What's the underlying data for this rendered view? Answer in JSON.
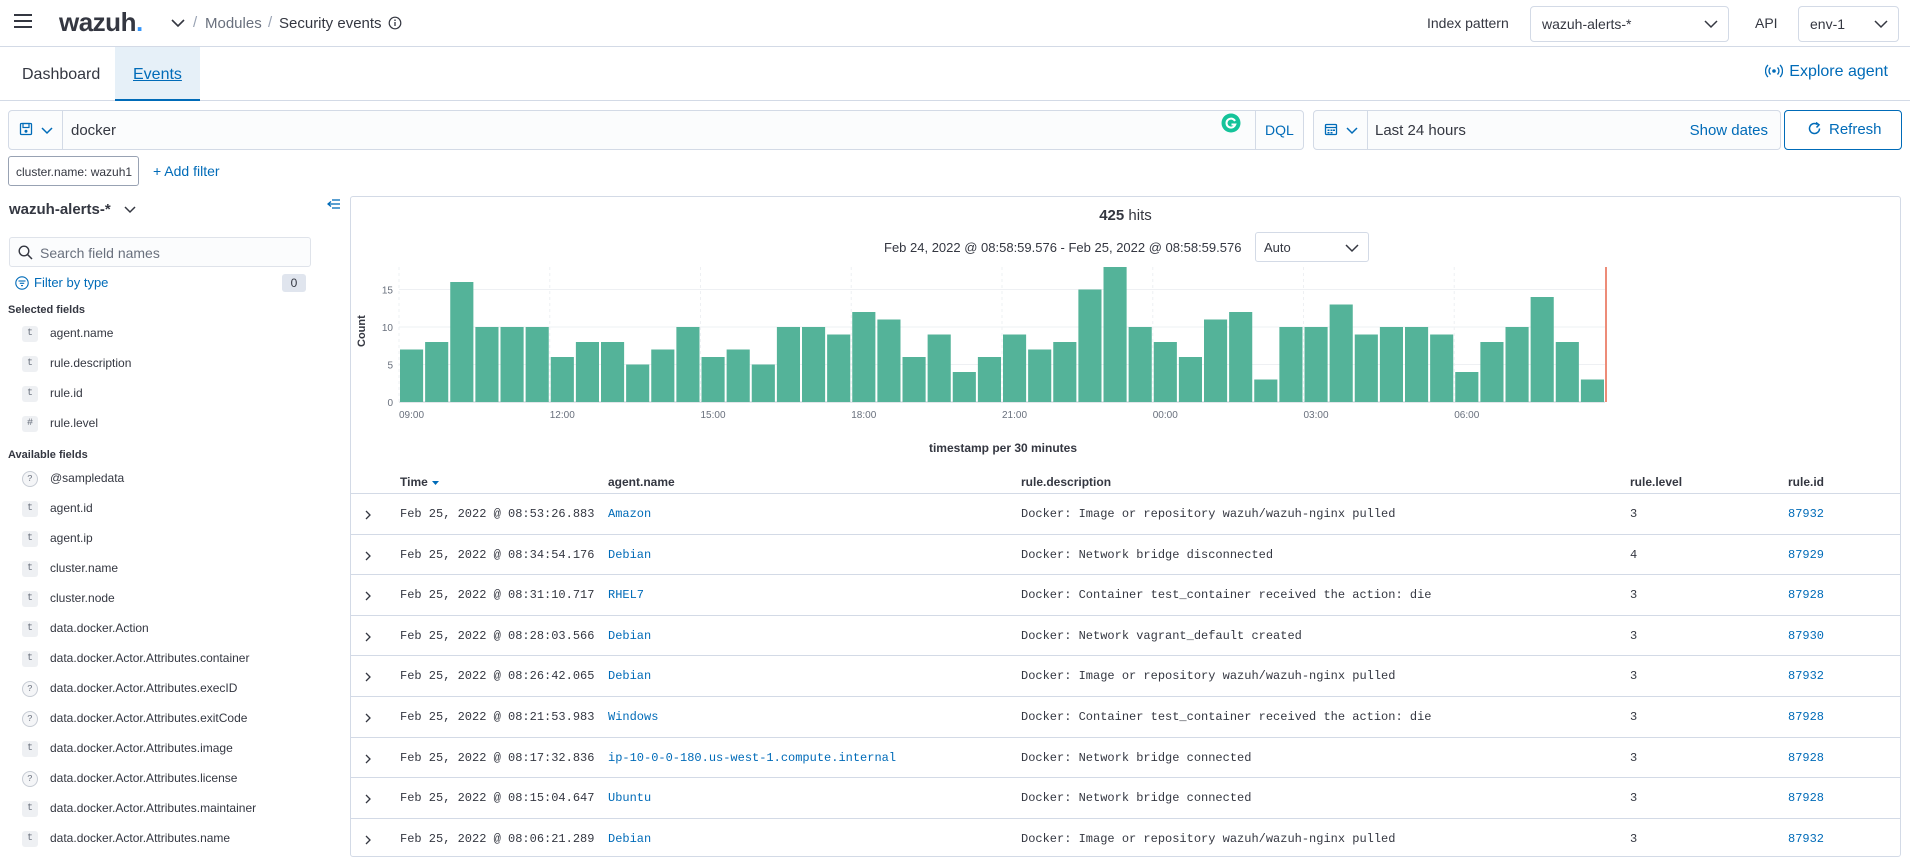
{
  "header": {
    "logo_text": "wazuh",
    "logo_dot": ".",
    "breadcrumb": [
      "Modules",
      "Security events"
    ],
    "index_pattern_label": "Index pattern",
    "index_pattern_value": "wazuh-alerts-*",
    "api_label": "API",
    "api_value": "env-1"
  },
  "tabs": [
    {
      "label": "Dashboard",
      "active": false
    },
    {
      "label": "Events",
      "active": true
    }
  ],
  "explore_agent_label": "Explore agent",
  "query": {
    "value": "docker",
    "language": "DQL"
  },
  "time": {
    "range_label": "Last 24 hours",
    "show_dates": "Show dates",
    "refresh": "Refresh"
  },
  "filters": {
    "pill": "cluster.name: wazuh1",
    "add_filter": "+ Add filter"
  },
  "sidebar": {
    "index_name": "wazuh-alerts-*",
    "search_placeholder": "Search field names",
    "filter_by_type": "Filter by type",
    "filter_count": "0",
    "selected_heading": "Selected fields",
    "selected_fields": [
      {
        "name": "agent.name",
        "type": "t"
      },
      {
        "name": "rule.description",
        "type": "t"
      },
      {
        "name": "rule.id",
        "type": "t"
      },
      {
        "name": "rule.level",
        "type": "#"
      }
    ],
    "available_heading": "Available fields",
    "available_fields": [
      {
        "name": "@sampledata",
        "type": "?"
      },
      {
        "name": "agent.id",
        "type": "t"
      },
      {
        "name": "agent.ip",
        "type": "t"
      },
      {
        "name": "cluster.name",
        "type": "t"
      },
      {
        "name": "cluster.node",
        "type": "t"
      },
      {
        "name": "data.docker.Action",
        "type": "t"
      },
      {
        "name": "data.docker.Actor.Attributes.container",
        "type": "t"
      },
      {
        "name": "data.docker.Actor.Attributes.execID",
        "type": "?"
      },
      {
        "name": "data.docker.Actor.Attributes.exitCode",
        "type": "?"
      },
      {
        "name": "data.docker.Actor.Attributes.image",
        "type": "t"
      },
      {
        "name": "data.docker.Actor.Attributes.license",
        "type": "?"
      },
      {
        "name": "data.docker.Actor.Attributes.maintainer",
        "type": "t"
      },
      {
        "name": "data.docker.Actor.Attributes.name",
        "type": "t"
      }
    ]
  },
  "results": {
    "hits_count": "425",
    "hits_label": "hits",
    "time_range": "Feb 24, 2022 @ 08:58:59.576 - Feb 25, 2022 @ 08:58:59.576",
    "interval": "Auto"
  },
  "chart_data": {
    "type": "bar",
    "title": "",
    "xlabel": "timestamp per 30 minutes",
    "ylabel": "Count",
    "ylim": [
      0,
      18
    ],
    "yticks": [
      0,
      5,
      10,
      15
    ],
    "xticks": [
      "09:00",
      "12:00",
      "15:00",
      "18:00",
      "21:00",
      "00:00",
      "03:00",
      "06:00"
    ],
    "bar_color": "#54b399",
    "marker_color": "#e7664c",
    "values": [
      7,
      8,
      16,
      10,
      10,
      10,
      6,
      8,
      8,
      5,
      7,
      10,
      6,
      7,
      5,
      10,
      10,
      9,
      12,
      11,
      6,
      9,
      4,
      6,
      9,
      7,
      8,
      15,
      18,
      10,
      8,
      6,
      11,
      12,
      3,
      10,
      10,
      13,
      9,
      10,
      10,
      9,
      4,
      8,
      10,
      14,
      8,
      3
    ]
  },
  "table": {
    "columns": [
      "Time",
      "agent.name",
      "rule.description",
      "rule.level",
      "rule.id"
    ],
    "rows": [
      [
        "Feb 25, 2022 @ 08:53:26.883",
        "Amazon",
        "Docker: Image or repository wazuh/wazuh-nginx pulled",
        "3",
        "87932"
      ],
      [
        "Feb 25, 2022 @ 08:34:54.176",
        "Debian",
        "Docker: Network bridge disconnected",
        "4",
        "87929"
      ],
      [
        "Feb 25, 2022 @ 08:31:10.717",
        "RHEL7",
        "Docker: Container test_container received the action: die",
        "3",
        "87928"
      ],
      [
        "Feb 25, 2022 @ 08:28:03.566",
        "Debian",
        "Docker: Network vagrant_default created",
        "3",
        "87930"
      ],
      [
        "Feb 25, 2022 @ 08:26:42.065",
        "Debian",
        "Docker: Image or repository wazuh/wazuh-nginx pulled",
        "3",
        "87932"
      ],
      [
        "Feb 25, 2022 @ 08:21:53.983",
        "Windows",
        "Docker: Container test_container received the action: die",
        "3",
        "87928"
      ],
      [
        "Feb 25, 2022 @ 08:17:32.836",
        "ip-10-0-0-180.us-west-1.compute.internal",
        "Docker: Network bridge connected",
        "3",
        "87928"
      ],
      [
        "Feb 25, 2022 @ 08:15:04.647",
        "Ubuntu",
        "Docker: Network bridge connected",
        "3",
        "87928"
      ],
      [
        "Feb 25, 2022 @ 08:06:21.289",
        "Debian",
        "Docker: Image or repository wazuh/wazuh-nginx pulled",
        "3",
        "87932"
      ]
    ]
  }
}
